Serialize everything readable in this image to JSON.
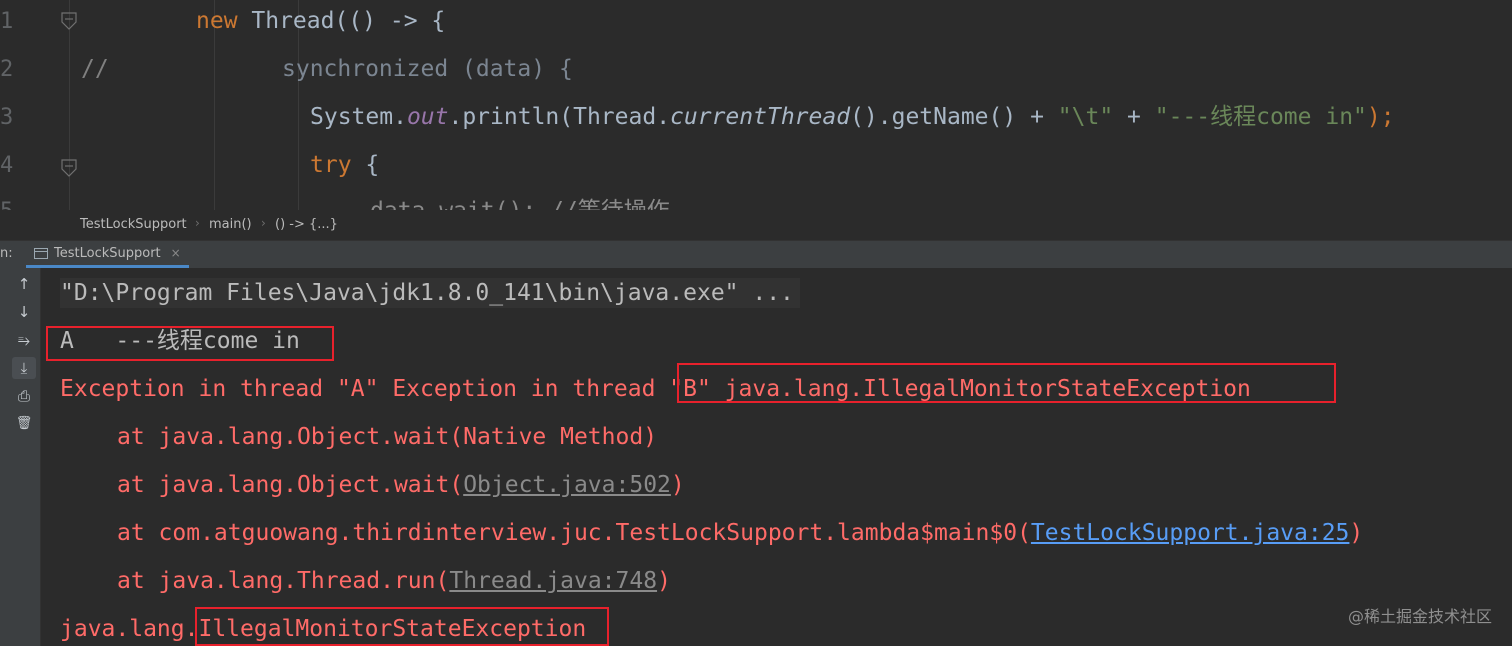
{
  "editor": {
    "line_numbers": [
      "1",
      "2",
      "3",
      "4",
      "5"
    ],
    "lines": [
      {
        "kw": "new",
        "rest": " Thread(() -> {"
      },
      {
        "comment": "//",
        "sync": "synchronized (data) {"
      },
      {
        "p1": "System.",
        "field": "out",
        "p2": ".println(Thread.",
        "italic": "currentThread",
        "p3": "().getName() + ",
        "s1": "\"\\t\"",
        "p4": " + ",
        "s2": "\"---线程come in\"",
        "p5": ");"
      },
      {
        "kw": "try",
        "rest": " {"
      },
      {
        "partial": "data.wait(); //等待操作"
      }
    ]
  },
  "breadcrumb": {
    "items": [
      "TestLockSupport",
      "main()",
      "() -> {...}"
    ]
  },
  "run_panel": {
    "label": "n:",
    "tab_title": "TestLockSupport",
    "close_glyph": "×"
  },
  "toolbar": {
    "up": "↑",
    "down": "↓",
    "wrap": "⥱",
    "scroll_end": "⤓",
    "print": "⎙",
    "clear": "🗑"
  },
  "console": {
    "command": "\"D:\\Program Files\\Java\\jdk1.8.0_141\\bin\\java.exe\" ...",
    "output_line": "A\t---线程come in",
    "exception_line": "Exception in thread \"A\" Exception in thread \"B\" java.lang.IllegalMonitorStateException",
    "stack": [
      {
        "text": "at java.lang.Object.wait(Native Method)"
      },
      {
        "prefix": "at java.lang.Object.wait(",
        "link": "Object.java:502",
        "suffix": ")"
      },
      {
        "prefix": "at com.atguowang.thirdinterview.juc.TestLockSupport.lambda$main$0(",
        "link": "TestLockSupport.java:25",
        "suffix": ")"
      },
      {
        "prefix": "at java.lang.Thread.run(",
        "link": "Thread.java:748",
        "suffix": ")"
      }
    ],
    "last_line": "java.lang.IllegalMonitorStateException"
  },
  "watermark": "@稀土掘金技术社区",
  "colors": {
    "background": "#2b2b2b",
    "error": "#ff6b68",
    "link": "#589df6",
    "highlight_box": "#e8212c",
    "keyword": "#cc7832",
    "string": "#6a8759"
  }
}
